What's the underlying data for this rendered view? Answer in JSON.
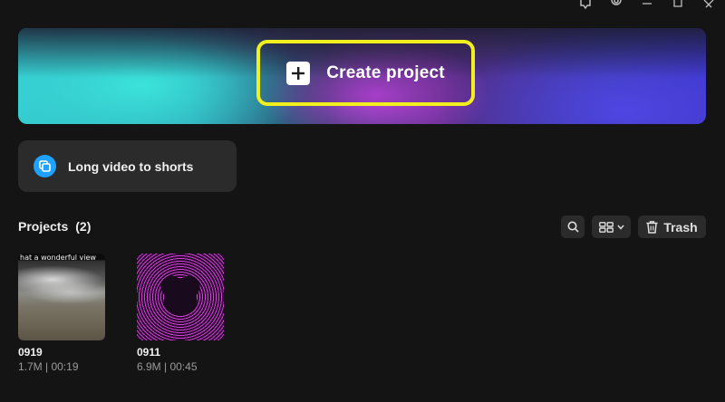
{
  "hero": {
    "create_label": "Create project"
  },
  "shortcut": {
    "long_video_label": "Long video to shorts"
  },
  "projects": {
    "title": "Projects",
    "count": "(2)",
    "trash_label": "Trash",
    "items": [
      {
        "name": "0919",
        "meta": "1.7M | 00:19",
        "caption": "hat a wonderful view"
      },
      {
        "name": "0911",
        "meta": "6.9M | 00:45"
      }
    ]
  },
  "colors": {
    "highlight_border": "#f2ef1e",
    "accent_blue": "#1ea1ff",
    "card_bg": "#2b2b2b",
    "page_bg": "#141414"
  },
  "icons": [
    "feedback-icon",
    "settings-icon",
    "minimize-icon",
    "maximize-icon",
    "close-icon",
    "plus-icon",
    "long-video-icon",
    "search-icon",
    "grid-view-icon",
    "chevron-down-icon",
    "trash-icon"
  ]
}
